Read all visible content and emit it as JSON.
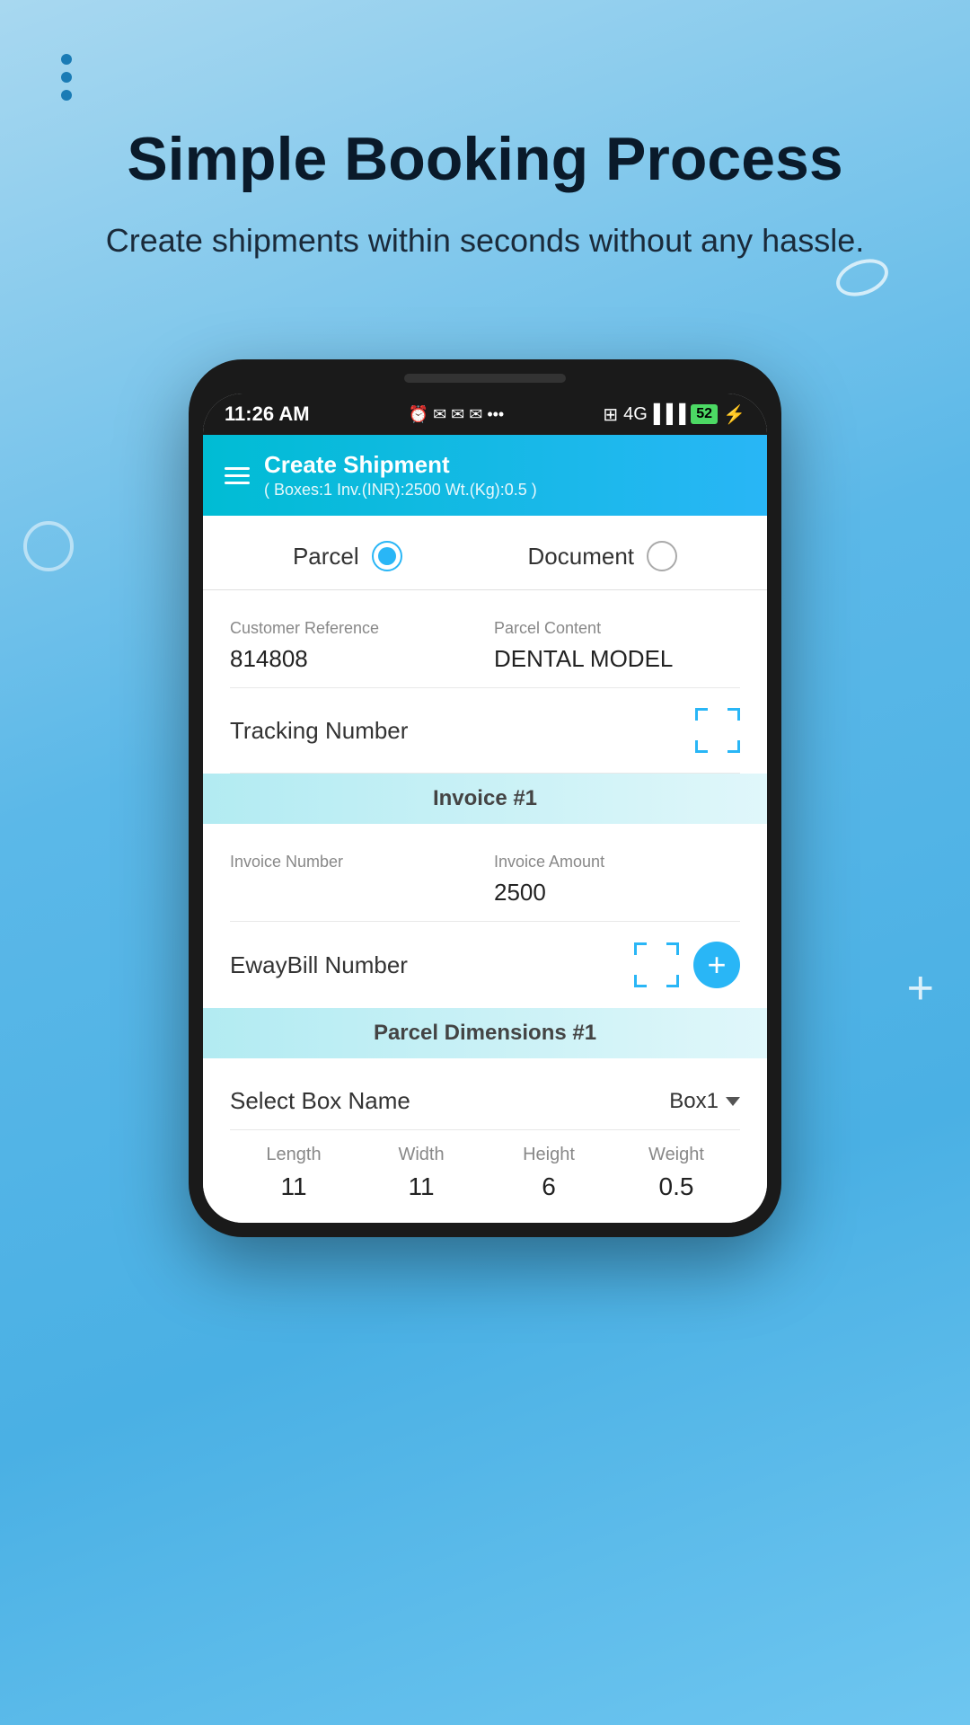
{
  "page": {
    "background": "gradient blue",
    "decorations": {
      "three_dots": true,
      "oval": true,
      "circle": true,
      "plus": "+"
    }
  },
  "hero": {
    "title": "Simple Booking Process",
    "subtitle": "Create shipments within seconds without any hassle."
  },
  "phone": {
    "status_bar": {
      "time": "11:26 AM",
      "icons_left": "⏰ ✉ ✉ ✉ ...",
      "signal": "4G",
      "battery": "52",
      "bolt": "⚡"
    },
    "header": {
      "title": "Create Shipment",
      "subtitle": "( Boxes:1  Inv.(INR):2500 Wt.(Kg):0.5 )"
    },
    "shipment_type": {
      "parcel_label": "Parcel",
      "parcel_selected": true,
      "document_label": "Document",
      "document_selected": false
    },
    "form": {
      "customer_reference_label": "Customer Reference",
      "customer_reference_value": "814808",
      "parcel_content_label": "Parcel Content",
      "parcel_content_value": "DENTAL MODEL",
      "tracking_number_label": "Tracking Number"
    },
    "invoice": {
      "section_title": "Invoice #1",
      "invoice_number_label": "Invoice Number",
      "invoice_amount_label": "Invoice Amount",
      "invoice_amount_value": "2500",
      "ewaybill_label": "EwayBill Number"
    },
    "dimensions": {
      "section_title": "Parcel Dimensions #1",
      "select_box_label": "Select Box Name",
      "select_box_value": "Box1",
      "length_label": "Length",
      "length_value": "11",
      "width_label": "Width",
      "width_value": "11",
      "height_label": "Height",
      "height_value": "6",
      "weight_label": "Weight",
      "weight_value": "0.5"
    }
  }
}
